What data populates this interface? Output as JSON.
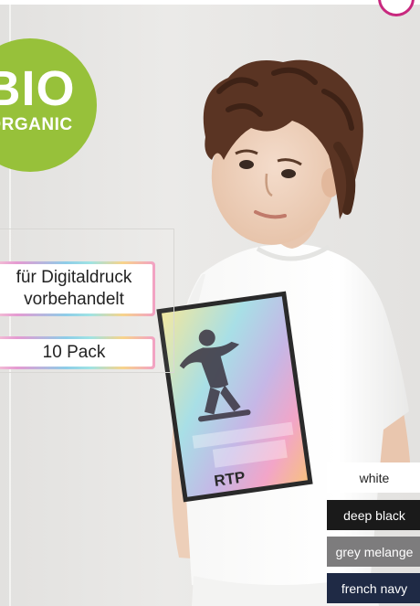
{
  "badge": {
    "main": "BIO",
    "sub": "ORGANIC"
  },
  "labels": {
    "digital_line1": "für Digitaldruck",
    "digital_line2": "vorbehandelt",
    "pack": "10 Pack"
  },
  "print_text": "RTP",
  "colors": [
    {
      "name": "white",
      "hex": "#ffffff"
    },
    {
      "name": "deep black",
      "hex": "#1a1a1a"
    },
    {
      "name": "grey melange",
      "hex": "#7d7c7d"
    },
    {
      "name": "french navy",
      "hex": "#1f2a45"
    }
  ],
  "accent": {
    "badge_green": "#97c13a",
    "logo_pink": "#c8287e"
  }
}
